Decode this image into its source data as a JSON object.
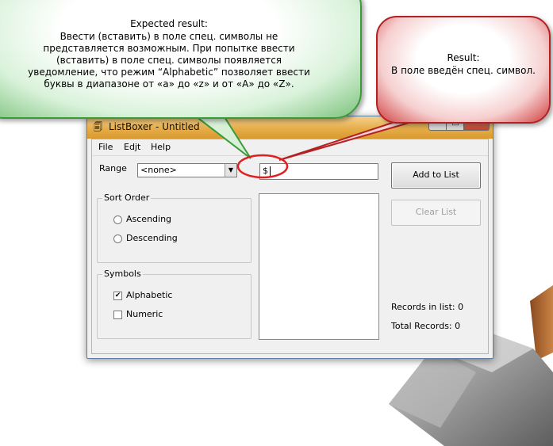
{
  "annotation_expected": {
    "title": "Expected result:",
    "text": "Ввести (вставить) в поле спец. символы не\nпредставляется возможным. При попытке ввести\n(вставить) в поле спец. символы  появляется\nуведомление, что режим   “Alphabetic” позволяет ввести\nбуквы в диапазоне от «a» до «z» и от «A» до «Z»."
  },
  "annotation_result": {
    "title": "Result:",
    "text": "В поле введён спец. символ."
  },
  "window": {
    "title": "ListBoxer - Untitled",
    "icon": "app-icon",
    "controls": {
      "minimize": "–",
      "maximize": "□",
      "close": "✕"
    }
  },
  "menu": {
    "file": "File",
    "edit": "Edjt",
    "help": "Help"
  },
  "range": {
    "label": "Range",
    "selected": "<none>"
  },
  "entry": {
    "value": "$"
  },
  "sort_order": {
    "title": "Sort Order",
    "ascending": "Ascending",
    "descending": "Descending"
  },
  "symbols": {
    "title": "Symbols",
    "alphabetic": "Alphabetic",
    "alphabetic_checked": "✔",
    "numeric": "Numeric"
  },
  "buttons": {
    "add": "Add to List",
    "clear": "Clear List"
  },
  "stats": {
    "records_in_list": "Records in list: 0",
    "total_records": "Total Records: 0"
  },
  "colors": {
    "green_border": "#3a9a3a",
    "red_border": "#b32222",
    "highlight_ellipse": "#e02020",
    "titlebar": "#e6ad4a"
  }
}
